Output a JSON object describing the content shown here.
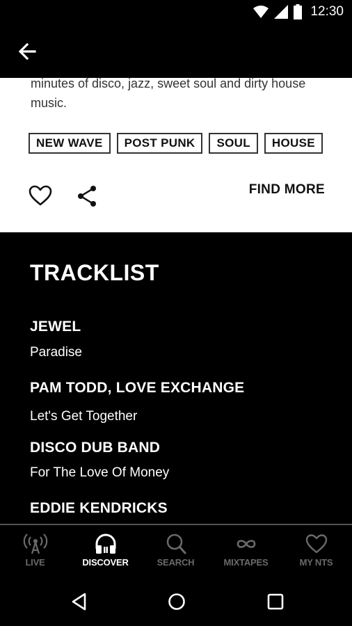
{
  "status_bar": {
    "time": "12:30"
  },
  "card": {
    "description": "minutes of disco, jazz, sweet soul and dirty house music.",
    "tags": [
      "NEW WAVE",
      "POST PUNK",
      "SOUL",
      "HOUSE"
    ],
    "find_more_label": "FIND MORE"
  },
  "tracklist": {
    "title": "TRACKLIST",
    "tracks": [
      {
        "artist": "JEWEL",
        "title": "Paradise"
      },
      {
        "artist": "PAM TODD, LOVE EXCHANGE",
        "title": "Let's Get Together"
      },
      {
        "artist": "DISCO DUB BAND",
        "title": "For The Love Of Money"
      },
      {
        "artist": "EDDIE KENDRICKS",
        "title": ""
      }
    ]
  },
  "bottom_nav": {
    "items": [
      {
        "label": "LIVE",
        "icon": "live-broadcast-icon"
      },
      {
        "label": "DISCOVER",
        "icon": "headphones-icon",
        "active": true
      },
      {
        "label": "SEARCH",
        "icon": "search-icon"
      },
      {
        "label": "MIXTAPES",
        "icon": "infinity-icon"
      },
      {
        "label": "MY NTS",
        "icon": "heart-icon"
      }
    ]
  },
  "colors": {
    "active": "#ffffff",
    "inactive": "#6a6a6a",
    "background": "#000000",
    "card": "#ffffff"
  }
}
